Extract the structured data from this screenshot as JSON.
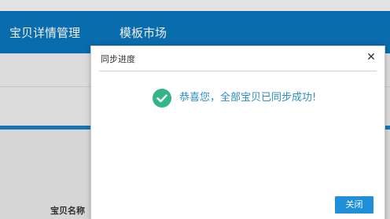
{
  "nav": {
    "items": [
      {
        "label": "宝贝详情管理"
      },
      {
        "label": "模板市场"
      }
    ]
  },
  "background": {
    "column_header": "宝贝名称"
  },
  "dialog": {
    "title": "同步进度",
    "close_symbol": "✕",
    "success_icon": "check-circle-icon",
    "message": "恭喜您，全部宝贝已同步成功!",
    "close_button_label": "关闭"
  },
  "colors": {
    "nav_bg": "#0a73b8",
    "success_green": "#33b58a",
    "message_blue": "#2a8fc6",
    "button_blue": "#1e8fd8"
  }
}
